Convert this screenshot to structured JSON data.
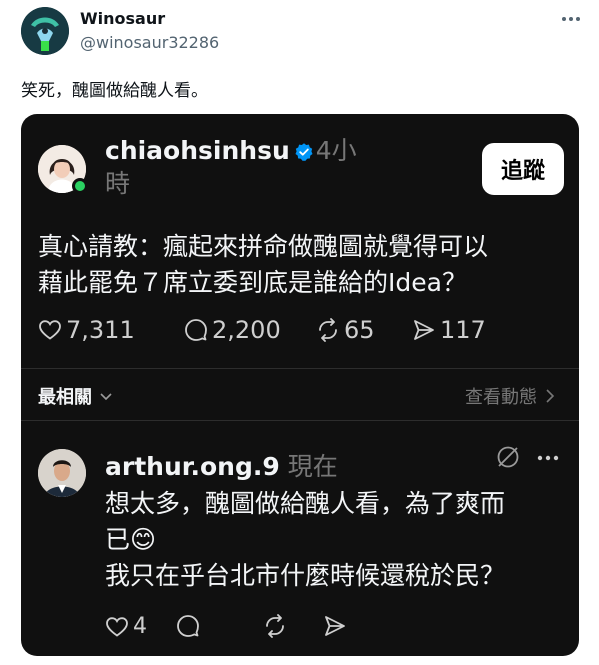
{
  "post": {
    "author_name": "Winosaur",
    "author_handle": "@winosaur32286",
    "text": "笑死，醜圖做給醜人看。"
  },
  "threads": {
    "username": "chiaohsinhsu",
    "time": "4小時",
    "follow_label": "追蹤",
    "body_line1": "真心請教：瘋起來拼命做醜圖就覺得可以",
    "body_line2": "藉此罷免７席立委到底是誰給的Idea？",
    "likes": "7,311",
    "replies": "2,200",
    "reposts": "65",
    "shares": "117",
    "sort_label": "最相關",
    "activity_label": "查看動態",
    "reply": {
      "username": "arthur.ong.9",
      "time": "現在",
      "line1": "想太多，醜圖做給醜人看，為了爽而",
      "line2": "已😊",
      "line3": "我只在乎台北市什麼時候還稅於民？",
      "likes": "4"
    }
  },
  "colors": {
    "card_bg": "#101010",
    "verified": "#0095f6",
    "online": "#2bd162"
  }
}
